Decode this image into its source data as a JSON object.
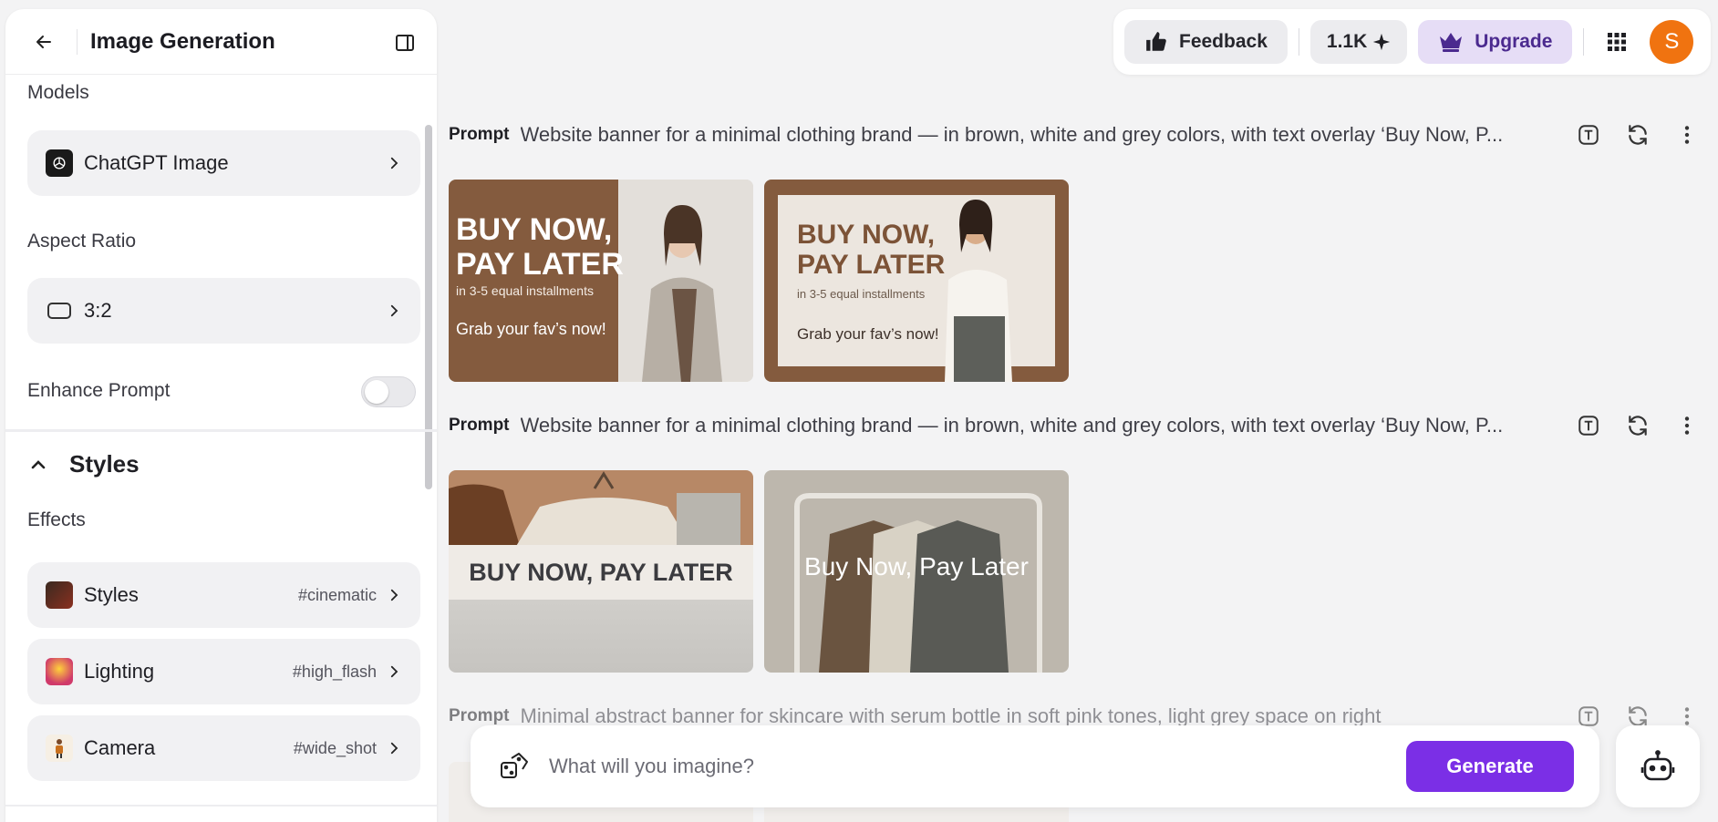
{
  "sidebar": {
    "title": "Image Generation",
    "models_label": "Models",
    "model_value": "ChatGPT Image",
    "aspect_label": "Aspect Ratio",
    "aspect_value": "3:2",
    "enhance_label": "Enhance Prompt",
    "enhance_on": false,
    "styles_heading": "Styles",
    "effects_label": "Effects",
    "effects": [
      {
        "label": "Styles",
        "tag": "#cinematic",
        "icon": "styles-thumb-icon"
      },
      {
        "label": "Lighting",
        "tag": "#high_flash",
        "icon": "lighting-thumb-icon"
      },
      {
        "label": "Camera",
        "tag": "#wide_shot",
        "icon": "camera-thumb-icon"
      }
    ]
  },
  "topbar": {
    "feedback_label": "Feedback",
    "credits_label": "1.1K",
    "upgrade_label": "Upgrade",
    "avatar_initial": "S"
  },
  "prompts": [
    {
      "label": "Prompt",
      "text": "Website banner for a minimal clothing brand — in brown, white and grey colors, with text overlay ‘Buy Now, P...",
      "images": [
        {
          "headline1": "BUY NOW,",
          "headline2": "PAY LATER",
          "sub": "in 3-5 equal installments",
          "cta": "Grab your fav’s now!"
        },
        {
          "headline1": "BUY NOW,",
          "headline2": "PAY LATER",
          "sub": "in 3-5 equal installments",
          "cta": "Grab your fav’s now!"
        }
      ]
    },
    {
      "label": "Prompt",
      "text": "Website banner for a minimal clothing brand — in brown, white and grey colors, with text overlay ‘Buy Now, P...",
      "images": [
        {
          "headline": "BUY NOW, PAY LATER"
        },
        {
          "headline": "Buy Now, Pay Later"
        }
      ]
    },
    {
      "label": "Prompt",
      "text": "Minimal abstract banner for skincare with serum bottle in soft pink tones, light grey space on right"
    }
  ],
  "composer": {
    "placeholder": "What will you imagine?",
    "generate_label": "Generate"
  },
  "colors": {
    "accent": "#7b2fe6",
    "avatar": "#f07310",
    "brown": "#845b3e"
  }
}
